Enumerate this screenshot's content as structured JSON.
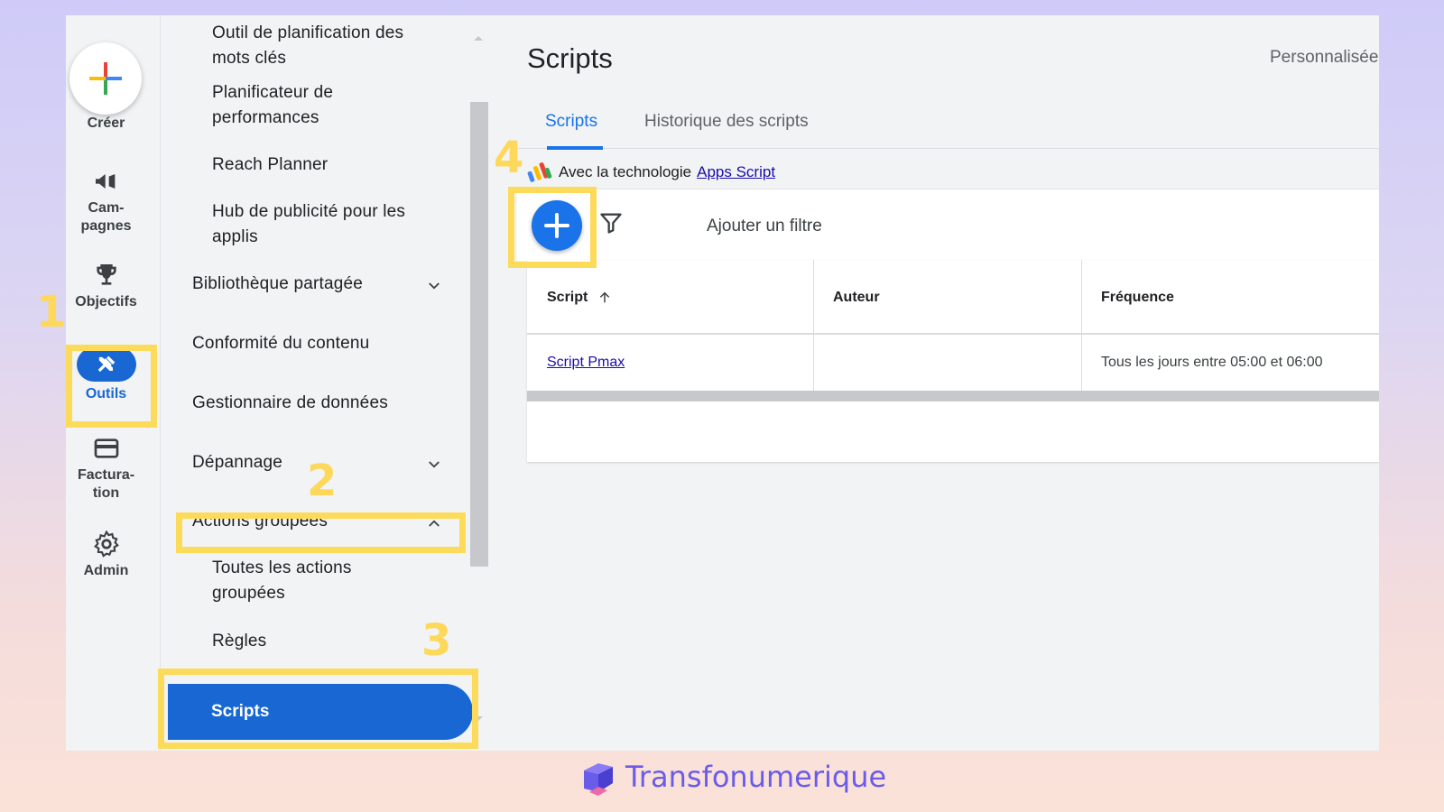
{
  "rail": {
    "create_label": "Créer",
    "campaigns_label": "Cam-\npagnes",
    "goals_label": "Objectifs",
    "tools_label": "Outils",
    "billing_label": "Factura-\ntion",
    "admin_label": "Admin"
  },
  "nav": {
    "item_keyword_planner": "Outil de planification des mots clés",
    "item_performance_planner": "Planificateur de performances",
    "item_reach_planner": "Reach Planner",
    "item_app_hub": "Hub de publicité pour les applis",
    "item_shared_library": "Bibliothèque partagée",
    "item_content_suitability": "Conformité du contenu",
    "item_data_manager": "Gestionnaire de données",
    "item_troubleshooting": "Dépannage",
    "item_bulk_actions": "Actions groupées",
    "item_all_bulk_actions": "Toutes les actions groupées",
    "item_rules": "Règles",
    "item_scripts": "Scripts"
  },
  "page": {
    "title": "Scripts",
    "personalized": "Personnalisée",
    "tab_scripts": "Scripts",
    "tab_history": "Historique des scripts",
    "powered_by": "Avec la technologie",
    "apps_script_link": "Apps Script",
    "add_filter": "Ajouter un filtre"
  },
  "table": {
    "col_script": "Script",
    "col_author": "Auteur",
    "col_frequency": "Fréquence",
    "rows": [
      {
        "script": "Script Pmax",
        "author": "",
        "frequency": "Tous les jours entre 05:00 et 06:00"
      }
    ]
  },
  "annotations": {
    "n1": "1",
    "n2": "2",
    "n3": "3",
    "n4": "4"
  },
  "brand": {
    "name": "Transfonumerique"
  },
  "colors": {
    "accent": "#1a73e8",
    "highlight": "#fddb5a",
    "brand": "#6a5ce8"
  }
}
